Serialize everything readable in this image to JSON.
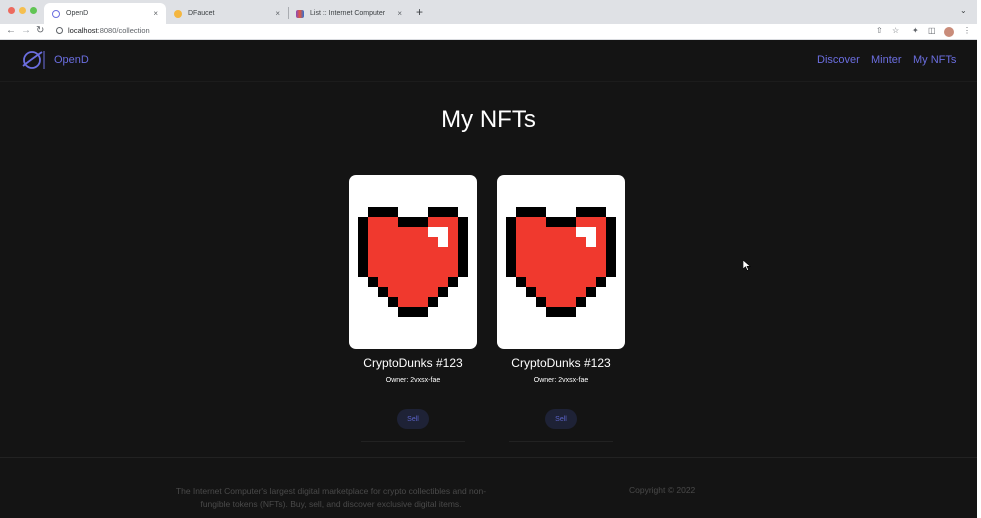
{
  "browser": {
    "tabs": [
      {
        "title": "OpenD",
        "active": true
      },
      {
        "title": "DFaucet",
        "active": false
      },
      {
        "title": "List :: Internet Computer",
        "active": false
      }
    ],
    "url_host": "localhost",
    "url_path": ":8080/collection",
    "new_tab_symbol": "+",
    "close_symbol": "×",
    "tab_menu_symbol": "⌄"
  },
  "header": {
    "brand": "OpenD",
    "nav": [
      "Discover",
      "Minter",
      "My NFTs"
    ]
  },
  "page_title": "My NFTs",
  "nfts": [
    {
      "name": "CryptoDunks #123",
      "owner": "Owner: 2vxsx-fae",
      "sell_label": "Sell"
    },
    {
      "name": "CryptoDunks #123",
      "owner": "Owner: 2vxsx-fae",
      "sell_label": "Sell"
    }
  ],
  "footer": {
    "description": "The Internet Computer's largest digital marketplace for crypto collectibles and non-fungible tokens (NFTs). Buy, sell, and discover exclusive digital items.",
    "copyright": "Copyright © 2022"
  },
  "colors": {
    "background": "#141414",
    "accent": "#6b6ee0",
    "heart_red": "#f0392e",
    "card": "#ffffff"
  },
  "icons": [
    "back-icon",
    "forward-icon",
    "reload-icon",
    "info-icon",
    "share-icon",
    "star-icon",
    "puzzle-icon",
    "sidebar-icon",
    "more-icon",
    "planet-logo-icon",
    "pixel-heart-icon",
    "cursor-icon"
  ]
}
